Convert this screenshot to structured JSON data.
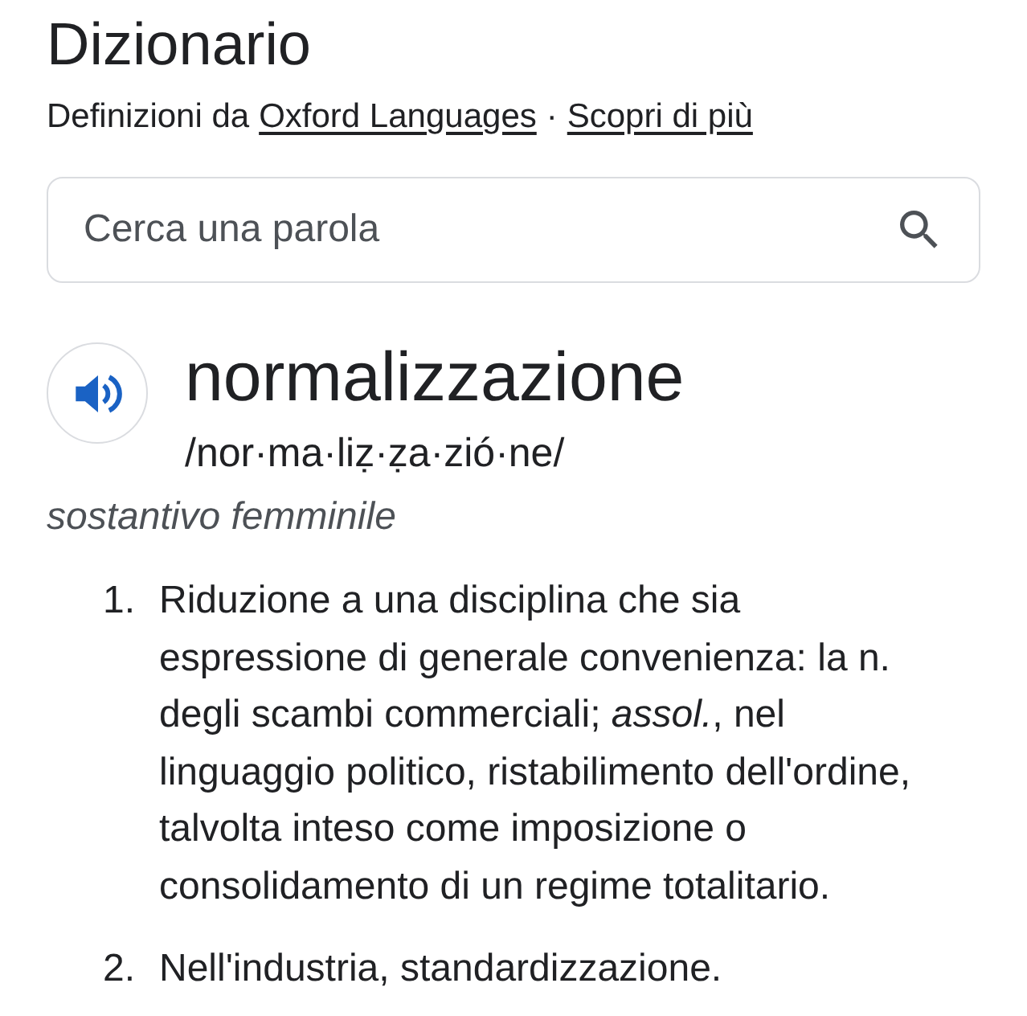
{
  "header": {
    "title": "Dizionario",
    "source_label": "Definizioni da",
    "source_link": "Oxford Languages",
    "separator": "·",
    "more_link": "Scopri di più"
  },
  "search": {
    "placeholder": "Cerca una parola"
  },
  "entry": {
    "headword": "normalizzazione",
    "pronunciation": "/nor·ma·liẓ·ẓa·zió·ne/",
    "part_of_speech": "sostantivo femminile",
    "definitions": [
      {
        "number": "1.",
        "text": "Riduzione a una disciplina che sia espressione di generale convenienza: la n. degli scambi commerciali; *assol.*, nel linguaggio politico, ristabilimento dell'ordine, talvolta inteso come imposizione o consolidamento di un regime totalitario."
      },
      {
        "number": "2.",
        "text": "Nell'industria, standardizzazione."
      }
    ]
  }
}
